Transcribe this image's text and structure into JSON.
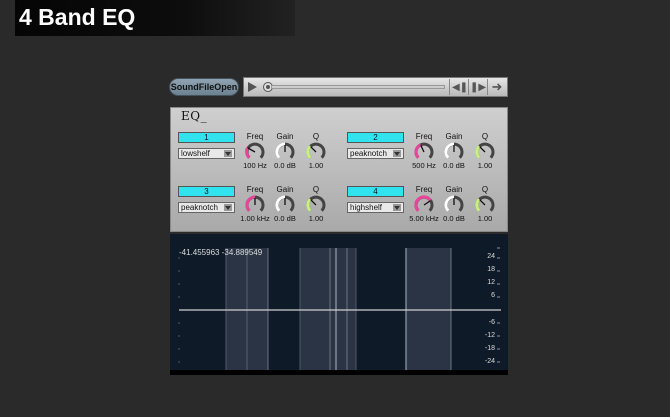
{
  "window": {
    "title": "4 Band EQ"
  },
  "player": {
    "button_label": "SoundFileOpen"
  },
  "eq": {
    "logo": "EQ_",
    "knob_labels": {
      "freq": "Freq",
      "gain": "Gain",
      "q": "Q"
    },
    "bands": [
      {
        "number": "1",
        "type": "lowshelf",
        "freq": "100 Hz",
        "gain": "0.0 dB",
        "q": "1.00"
      },
      {
        "number": "2",
        "type": "peaknotch",
        "freq": "500 Hz",
        "gain": "0.0 dB",
        "q": "1.00"
      },
      {
        "number": "3",
        "type": "peaknotch",
        "freq": "1.00 kHz",
        "gain": "0.0 dB",
        "q": "1.00"
      },
      {
        "number": "4",
        "type": "highshelf",
        "freq": "5.00 kHz",
        "gain": "0.0 dB",
        "q": "1.00"
      }
    ]
  },
  "display": {
    "readout": "-41.455963 -34.889549",
    "y_axis_labels": [
      "24",
      "18",
      "12",
      "6",
      "-6",
      "-12",
      "-18",
      "-24"
    ]
  },
  "colors": {
    "band_label_bg": "#31e3ee",
    "freq_knob": "#e8449a",
    "gain_knob": "#ffffff",
    "q_knob": "#c6f27a",
    "display_bg": "#0e1a28",
    "response_line": "#d0d0d0"
  },
  "icons": {
    "play": "play-icon",
    "position": "position-knob-icon",
    "previous": "skip-back-icon",
    "next": "skip-forward-icon",
    "loop": "loop-arrow-icon"
  }
}
